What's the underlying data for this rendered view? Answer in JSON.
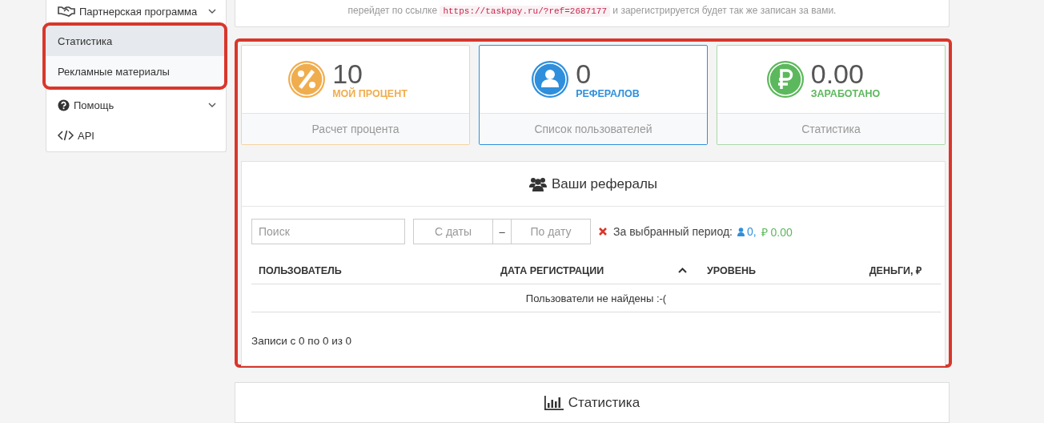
{
  "referral_note": {
    "text_before": "перейдет по ссылке",
    "link": "https://taskpay.ru/?ref=2687177",
    "text_after": "и зарегистрируется будет так же записан за вами."
  },
  "sidebar": {
    "items": [
      {
        "label": "Партнерская программа",
        "kind": "group",
        "expanded": true,
        "highlighted": true,
        "children": [
          {
            "label": "Статистика",
            "selected": true
          },
          {
            "label": "Рекламные материалы",
            "selected": false
          }
        ]
      },
      {
        "label": "Помощь",
        "kind": "group",
        "expanded": false
      },
      {
        "label": "API",
        "kind": "link"
      }
    ]
  },
  "stats_panel": {
    "highlighted": true,
    "cards": [
      {
        "value": "10",
        "label": "МОЙ ПРОЦЕНТ",
        "action": "Расчет процента",
        "color": "#f0ad4e",
        "selected": false
      },
      {
        "value": "0",
        "label": "РЕФЕРАЛОВ",
        "action": "Список пользователей",
        "color": "#2f8fdc",
        "selected": true
      },
      {
        "value": "0.00",
        "label": "ЗАРАБОТАНО",
        "action": "Статистика",
        "color": "#5cb85c",
        "selected": false
      }
    ],
    "referrals": {
      "title": "Ваши рефералы",
      "search": {
        "placeholder": "Поиск"
      },
      "date_from": {
        "placeholder": "С даты"
      },
      "date_separator": "–",
      "date_to": {
        "placeholder": "По дату"
      },
      "period_label": "За выбранный период:",
      "period_users": "0,",
      "currency_sign": "₽",
      "period_money": "0.00",
      "table": {
        "columns": [
          {
            "label": "ПОЛЬЗОВАТЕЛЬ",
            "sorted": false
          },
          {
            "label": "ДАТА РЕГИСТРАЦИИ",
            "sorted": true
          },
          {
            "label": "УРОВЕНЬ",
            "sorted": false
          },
          {
            "label": "ДЕНЬГИ, ₽",
            "sorted": false
          }
        ],
        "empty_message": "Пользователи не найдены :-("
      },
      "footer": "Записи с 0 по 0 из 0"
    }
  },
  "statistics_section": {
    "title": "Статистика"
  }
}
